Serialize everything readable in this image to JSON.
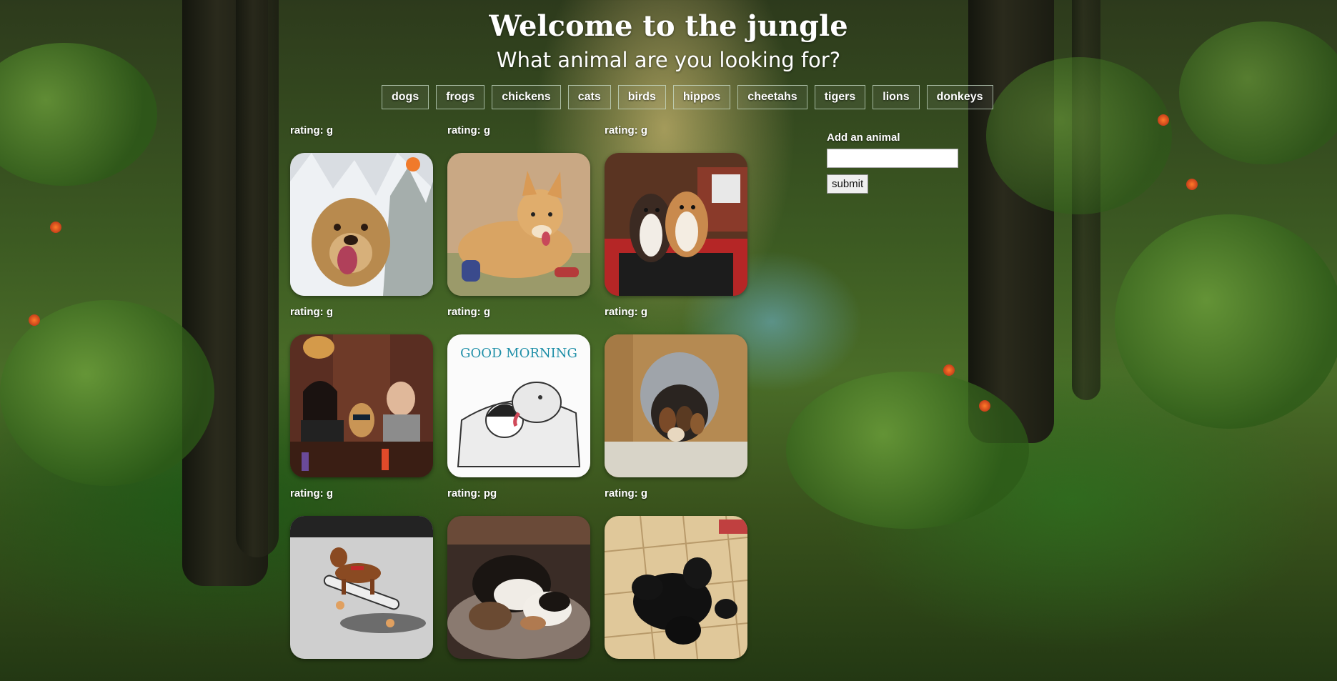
{
  "header": {
    "title": "Welcome to the jungle",
    "subtitle": "What animal are you looking for?"
  },
  "animal_buttons": [
    "dogs",
    "frogs",
    "chickens",
    "cats",
    "birds",
    "hippos",
    "cheetahs",
    "tigers",
    "lions",
    "donkeys"
  ],
  "gifs": [
    {
      "rating": "rating: g",
      "scene": "golden retriever in snow"
    },
    {
      "rating": "rating: g",
      "scene": "corgi lying on floor"
    },
    {
      "rating": "rating: g",
      "scene": "two dogs on treadmill"
    },
    {
      "rating": "rating: g",
      "scene": "people and dog with sunglasses at table"
    },
    {
      "rating": "rating: g",
      "scene": "good morning cartoon dog licking sleeper"
    },
    {
      "rating": "rating: g",
      "scene": "puppies in pet bed"
    },
    {
      "rating": "rating: g",
      "scene": "dachshund on skateboard"
    },
    {
      "rating": "rating: pg",
      "scene": "basset hounds sleeping"
    },
    {
      "rating": "rating: g",
      "scene": "black puppies on tile floor"
    }
  ],
  "cartoon_text": "GOOD MORNING",
  "add_form": {
    "label": "Add an animal",
    "input_value": "",
    "submit_label": "submit"
  },
  "colors": {
    "background_dark": "#233813",
    "background_mid": "#4a6d28",
    "text": "#ffffff"
  }
}
